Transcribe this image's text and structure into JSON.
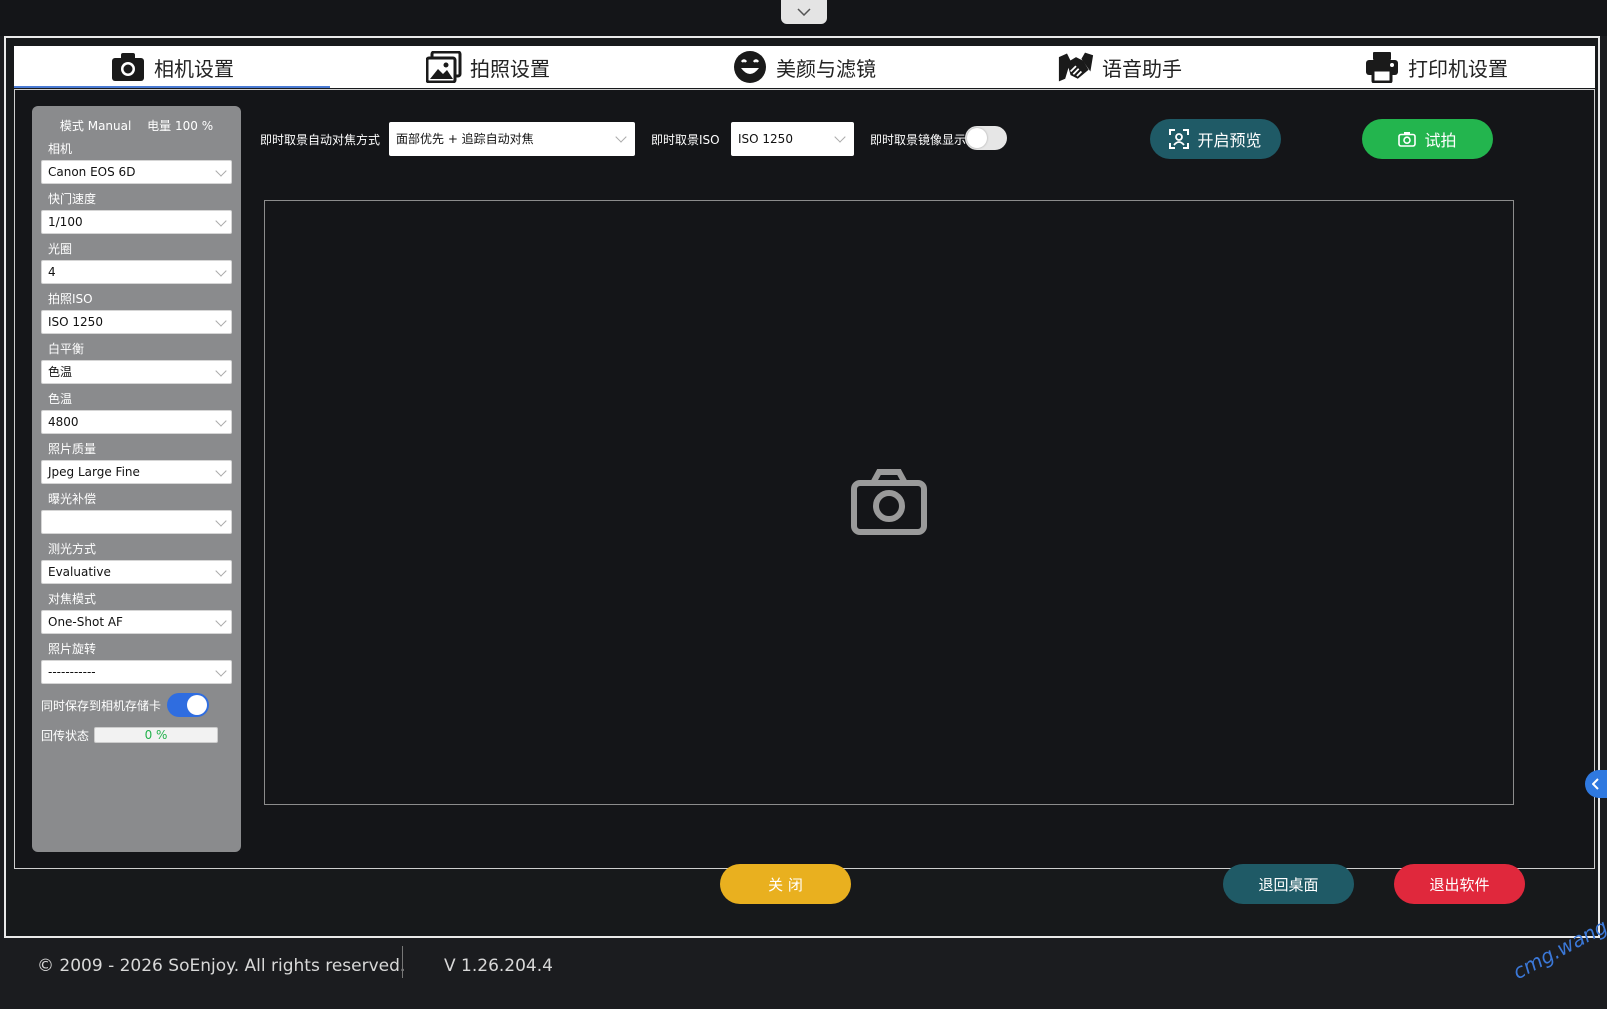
{
  "tabs": [
    {
      "label": "相机设置",
      "icon": "camera-icon",
      "active": true
    },
    {
      "label": "拍照设置",
      "icon": "gallery-icon",
      "active": false
    },
    {
      "label": "美颜与滤镜",
      "icon": "smile-icon",
      "active": false
    },
    {
      "label": "语音助手",
      "icon": "handshake-icon",
      "active": false
    },
    {
      "label": "打印机设置",
      "icon": "printer-icon",
      "active": false
    }
  ],
  "sidebar": {
    "mode_text": "模式 Manual",
    "battery_text": "电量 100 %",
    "fields": [
      {
        "label": "相机",
        "value": "Canon EOS 6D"
      },
      {
        "label": "快门速度",
        "value": "1/100"
      },
      {
        "label": "光圈",
        "value": "4"
      },
      {
        "label": "拍照ISO",
        "value": "ISO 1250"
      },
      {
        "label": "白平衡",
        "value": "色温"
      },
      {
        "label": "色温",
        "value": "4800"
      },
      {
        "label": "照片质量",
        "value": "Jpeg Large Fine"
      },
      {
        "label": "曝光补偿",
        "value": ""
      },
      {
        "label": "测光方式",
        "value": "Evaluative"
      },
      {
        "label": "对焦模式",
        "value": "One-Shot AF"
      },
      {
        "label": "照片旋转",
        "value": "-----------"
      }
    ],
    "save_to_card_label": "同时保存到相机存储卡",
    "save_to_card_on": true,
    "transfer_label": "回传状态",
    "transfer_percent_text": "0 %",
    "transfer_progress": 0
  },
  "toolbar": {
    "af_label": "即时取景自动对焦方式",
    "af_value": "面部优先 + 追踪自动对焦",
    "iso_label": "即时取景ISO",
    "iso_value": "ISO 1250",
    "mirror_label": "即时取景镜像显示",
    "mirror_on": false,
    "preview_button": "开启预览",
    "test_shot_button": "试拍"
  },
  "actions": {
    "close": "关 闭",
    "back_desktop": "退回桌面",
    "exit": "退出软件"
  },
  "footer": {
    "copyright": "© 2009 - 2026 SoEnjoy. All rights reserved.",
    "version": "V 1.26.204.4"
  },
  "watermark": "cmg.wang",
  "colors": {
    "preview_btn": "#1f5a66",
    "test_btn": "#23b54e",
    "close_btn": "#e9b01f",
    "desktop_btn": "#1f5a66",
    "exit_btn": "#e0283c",
    "accent": "#2f6de0"
  }
}
